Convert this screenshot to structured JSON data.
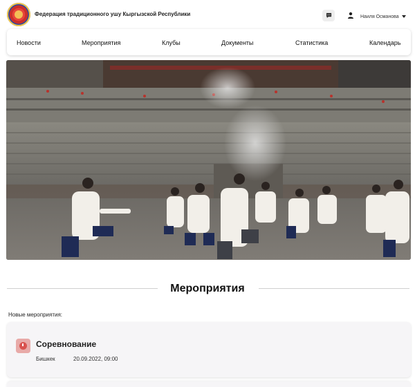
{
  "header": {
    "org_name": "Федерация традиционного ушу Кыргызской Республики",
    "user_name": "Наиля Османова"
  },
  "nav": {
    "items": [
      {
        "label": "Новости"
      },
      {
        "label": "Мероприятия"
      },
      {
        "label": "Клубы"
      },
      {
        "label": "Документы"
      },
      {
        "label": "Статистика"
      },
      {
        "label": "Календарь"
      }
    ]
  },
  "hero": {
    "image": "tai-chi-practitioners-temple-courtyard"
  },
  "section": {
    "title": "Мероприятия",
    "subtitle": "Новые мероприятия:"
  },
  "events": [
    {
      "title": "Соревнование",
      "city": "Бишкек",
      "datetime": "20.09.2022, 09:00",
      "icon": "clock-icon",
      "icon_color": "#d9534f"
    }
  ],
  "colors": {
    "card_bg": "#f6f5f7",
    "icon_bg": "#e8aaa8",
    "accent": "#d9534f"
  }
}
